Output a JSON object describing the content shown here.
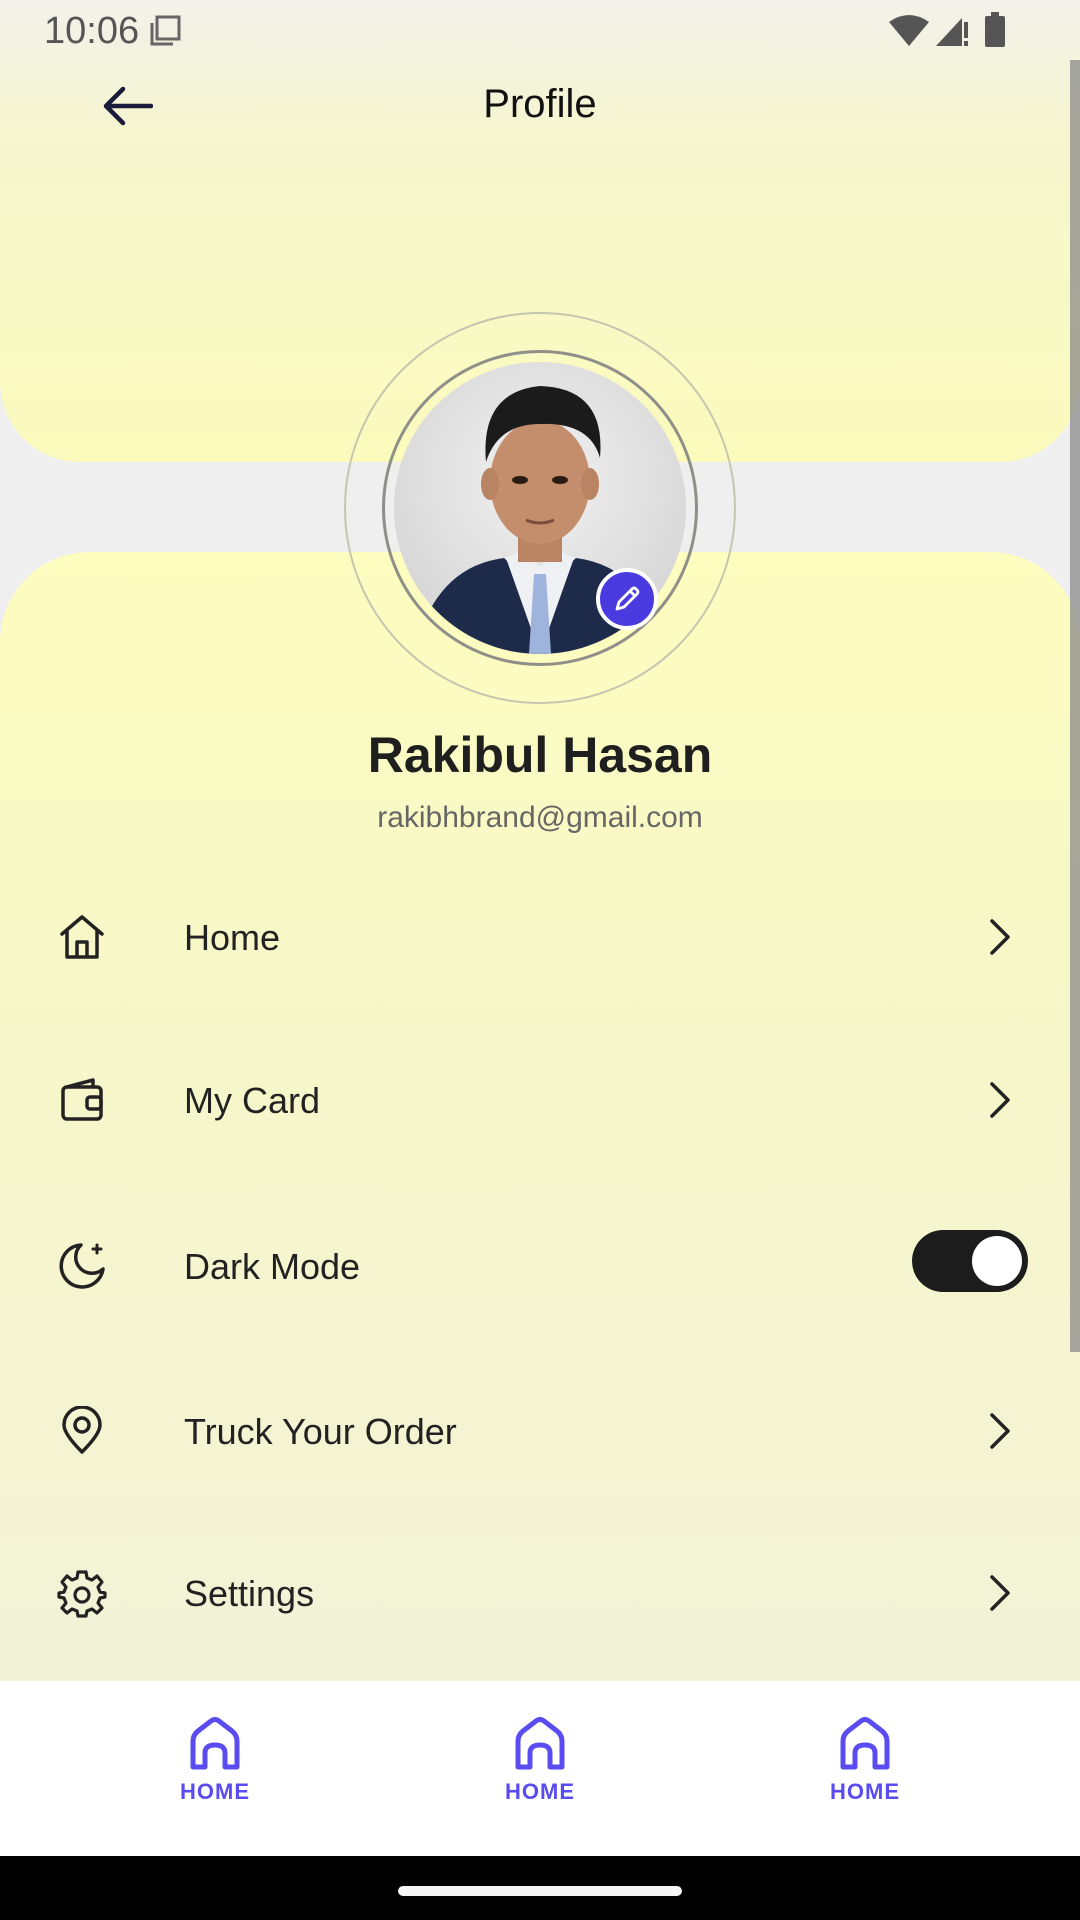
{
  "status_bar": {
    "time": "10:06"
  },
  "app_bar": {
    "title": "Profile"
  },
  "profile": {
    "name": "Rakibul Hasan",
    "email": "rakibhbrand@gmail.com"
  },
  "menu": [
    {
      "label": "Home",
      "icon": "home-icon",
      "trailing": "chevron"
    },
    {
      "label": "My Card",
      "icon": "wallet-icon",
      "trailing": "chevron"
    },
    {
      "label": "Dark Mode",
      "icon": "moon-icon",
      "trailing": "toggle",
      "toggle_on": true
    },
    {
      "label": "Truck Your Order",
      "icon": "location-pin-icon",
      "trailing": "chevron"
    },
    {
      "label": "Settings",
      "icon": "gear-icon",
      "trailing": "chevron"
    }
  ],
  "bottom_nav": [
    {
      "label": "HOME",
      "icon": "home-icon"
    },
    {
      "label": "HOME",
      "icon": "home-icon"
    },
    {
      "label": "HOME",
      "icon": "home-icon"
    }
  ],
  "colors": {
    "accent": "#4a3be0",
    "nav_accent": "#5a4cf0",
    "header_yellow": "#fbfbbd",
    "toggle_track": "#1c1c1c"
  }
}
